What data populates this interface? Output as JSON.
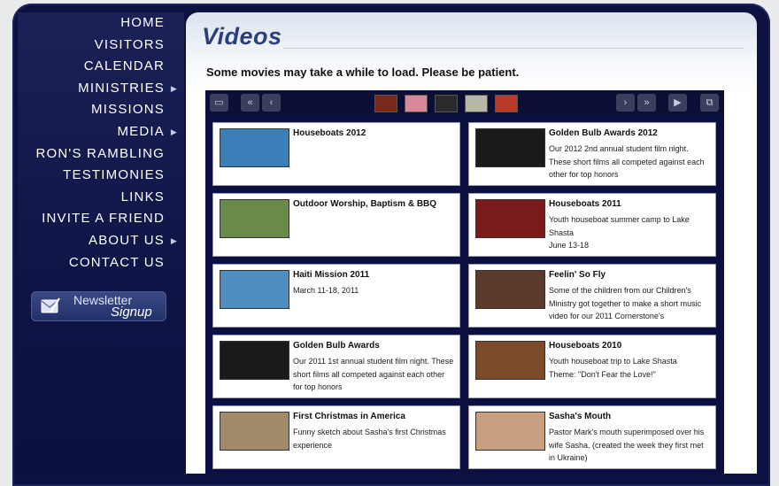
{
  "nav": {
    "items": [
      {
        "label": "HOME",
        "sub": false
      },
      {
        "label": "VISITORS",
        "sub": false
      },
      {
        "label": "CALENDAR",
        "sub": false
      },
      {
        "label": "MINISTRIES",
        "sub": true
      },
      {
        "label": "MISSIONS",
        "sub": false
      },
      {
        "label": "MEDIA",
        "sub": true
      },
      {
        "label": "RON'S RAMBLING",
        "sub": false
      },
      {
        "label": "TESTIMONIES",
        "sub": false
      },
      {
        "label": "LINKS",
        "sub": false
      },
      {
        "label": "INVITE A FRIEND",
        "sub": false
      },
      {
        "label": "ABOUT US",
        "sub": true
      },
      {
        "label": "CONTACT US",
        "sub": false
      }
    ],
    "newsletter": {
      "word1": "Newsletter",
      "word2": "Signup"
    }
  },
  "page": {
    "title": "Videos",
    "notice": "Some movies may take a while to load. Please be patient."
  },
  "toolbar": {
    "glyphs": {
      "fullscreen": "▭",
      "first": "«",
      "prev": "‹",
      "next": "›",
      "last": "»",
      "play": "▶",
      "popout": "⧉"
    }
  },
  "videos": [
    {
      "title": "Houseboats 2012",
      "desc": "",
      "thumb": "#3a7fb8"
    },
    {
      "title": "Golden Bulb Awards 2012",
      "desc": "Our 2012 2nd annual student film night. These short films all competed against each other for top honors",
      "thumb": "#1a1a1a"
    },
    {
      "title": "Outdoor Worship, Baptism & BBQ",
      "desc": "",
      "thumb": "#6a8a4a"
    },
    {
      "title": "Houseboats 2011",
      "desc": "Youth houseboat summer camp to Lake Shasta\nJune 13-18",
      "thumb": "#7a1a1a"
    },
    {
      "title": "Haiti Mission 2011",
      "desc": "March 11-18, 2011",
      "thumb": "#4f8fc0"
    },
    {
      "title": "Feelin' So Fly",
      "desc": "Some of the children from our Children's Ministry got together to make a short music video for our 2011 Cornerstone's",
      "thumb": "#5a3a2a"
    },
    {
      "title": "Golden Bulb Awards",
      "desc": "Our 2011 1st annual student film night. These short films all competed against each other for top honors",
      "thumb": "#1a1a1a"
    },
    {
      "title": "Houseboats 2010",
      "desc": "Youth houseboat trip to Lake Shasta\nTheme: \"Don't Fear the Love!\"",
      "thumb": "#7a4a2a"
    },
    {
      "title": "First Christmas in America",
      "desc": "Funny sketch about Sasha's first Christmas experience",
      "thumb": "#a08a6a"
    },
    {
      "title": "Sasha's Mouth",
      "desc": "Pastor Mark's mouth superimposed over his wife Sasha. (created the week they first met in Ukraine)",
      "thumb": "#c8a080"
    }
  ],
  "strip": [
    "#7a2a1a",
    "#d88a9a",
    "#2a2a2a",
    "#b8b8a8",
    "#b83a2a"
  ]
}
